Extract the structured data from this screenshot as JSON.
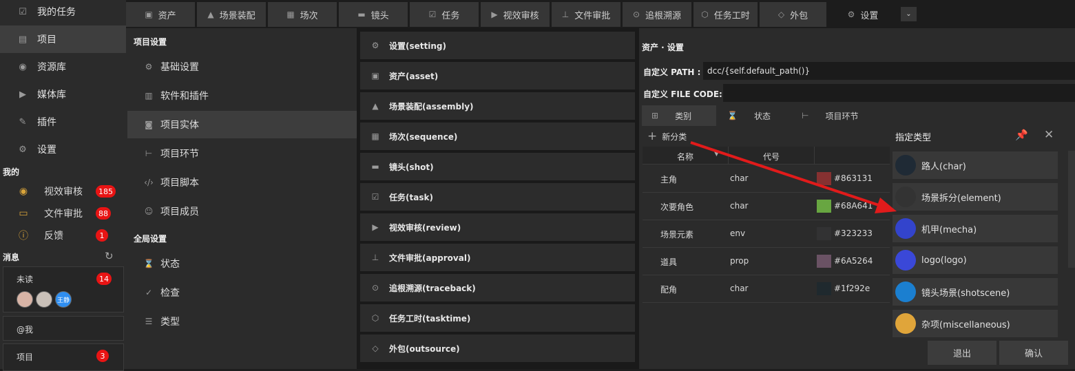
{
  "nav": {
    "items": [
      {
        "label": "我的任务",
        "icon": "checkbox-icon"
      },
      {
        "label": "项目",
        "icon": "project-icon"
      },
      {
        "label": "资源库",
        "icon": "library-icon"
      },
      {
        "label": "媒体库",
        "icon": "media-icon"
      },
      {
        "label": "插件",
        "icon": "plugin-icon"
      },
      {
        "label": "设置",
        "icon": "gear-icon"
      }
    ],
    "my_title": "我的",
    "my_items": [
      {
        "label": "视效审核",
        "badge": "185",
        "icon": "eye-icon"
      },
      {
        "label": "文件审批",
        "badge": "88",
        "icon": "folder-icon"
      },
      {
        "label": "反馈",
        "badge": "1",
        "icon": "info-icon"
      }
    ],
    "messages_title": "消息",
    "unread": {
      "label": "未读",
      "badge": "14",
      "avatar_text": "王静"
    },
    "at_me": "@我",
    "project_msg": {
      "label": "项目",
      "badge": "3"
    }
  },
  "tabs": [
    {
      "label": "资产",
      "icon": "asset-icon"
    },
    {
      "label": "场景装配",
      "icon": "assembly-icon"
    },
    {
      "label": "场次",
      "icon": "sequence-icon"
    },
    {
      "label": "镜头",
      "icon": "shot-icon"
    },
    {
      "label": "任务",
      "icon": "task-icon"
    },
    {
      "label": "视效审核",
      "icon": "review-icon"
    },
    {
      "label": "文件审批",
      "icon": "approval-icon"
    },
    {
      "label": "追根溯源",
      "icon": "traceback-icon"
    },
    {
      "label": "任务工时",
      "icon": "tasktime-icon"
    },
    {
      "label": "外包",
      "icon": "outsource-icon"
    },
    {
      "label": "设置",
      "icon": "gear-icon"
    }
  ],
  "settings_side": {
    "project_head": "项目设置",
    "project_items": [
      {
        "label": "基础设置",
        "icon": "gear-icon"
      },
      {
        "label": "软件和插件",
        "icon": "chart-icon"
      },
      {
        "label": "项目实体",
        "icon": "entity-icon"
      },
      {
        "label": "项目环节",
        "icon": "pipeline-icon"
      },
      {
        "label": "项目脚本",
        "icon": "code-icon"
      },
      {
        "label": "项目成员",
        "icon": "members-icon"
      }
    ],
    "global_head": "全局设置",
    "global_items": [
      {
        "label": "状态",
        "icon": "hourglass-icon"
      },
      {
        "label": "检查",
        "icon": "check-circle-icon"
      },
      {
        "label": "类型",
        "icon": "list-icon"
      }
    ]
  },
  "entities": [
    {
      "label": "设置(setting)",
      "icon": "gear-icon"
    },
    {
      "label": "资产(asset)",
      "icon": "asset-icon"
    },
    {
      "label": "场景装配(assembly)",
      "icon": "assembly-icon"
    },
    {
      "label": "场次(sequence)",
      "icon": "sequence-icon"
    },
    {
      "label": "镜头(shot)",
      "icon": "shot-icon"
    },
    {
      "label": "任务(task)",
      "icon": "task-icon"
    },
    {
      "label": "视效审核(review)",
      "icon": "review-icon"
    },
    {
      "label": "文件审批(approval)",
      "icon": "approval-icon"
    },
    {
      "label": "追根溯源(traceback)",
      "icon": "traceback-icon"
    },
    {
      "label": "任务工时(tasktime)",
      "icon": "tasktime-icon"
    },
    {
      "label": "外包(outsource)",
      "icon": "outsource-icon"
    }
  ],
  "detail": {
    "title": "资产 · 设置",
    "path_label": "自定义 PATH :",
    "path_value": "dcc/{self.default_path()}",
    "filecode_label": "自定义 FILE CODE:",
    "filecode_value": "",
    "subtabs": [
      {
        "label": "类别",
        "icon": "grid-icon"
      },
      {
        "label": "状态",
        "icon": "hourglass-icon"
      },
      {
        "label": "项目环节",
        "icon": "pipeline-icon"
      }
    ],
    "new_category": "新分类",
    "columns": {
      "name": "名称",
      "code": "代号"
    },
    "rows": [
      {
        "name": "主角",
        "code": "char",
        "color": "#863131"
      },
      {
        "name": "次要角色",
        "code": "char",
        "color": "#68A641"
      },
      {
        "name": "场景元素",
        "code": "env",
        "color": "#323233"
      },
      {
        "name": "道具",
        "code": "prop",
        "color": "#6A5264"
      },
      {
        "name": "配角",
        "code": "char",
        "color": "#1f292e"
      }
    ]
  },
  "popup": {
    "title": "指定类型",
    "options": [
      {
        "label": "路人(char)",
        "color": "#1f2a35"
      },
      {
        "label": "场景拆分(element)",
        "color": "#333333"
      },
      {
        "label": "机甲(mecha)",
        "color": "#3344cc"
      },
      {
        "label": "logo(logo)",
        "color": "#3a48d8"
      },
      {
        "label": "镜头场景(shotscene)",
        "color": "#1b7fd0"
      },
      {
        "label": "杂项(miscellaneous)",
        "color": "#e0a53a"
      }
    ],
    "cancel": "退出",
    "confirm": "确认"
  },
  "arrow_color": "#e11b1b"
}
